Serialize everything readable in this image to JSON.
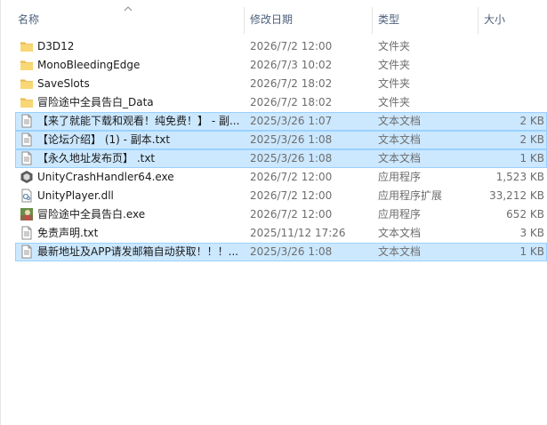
{
  "columns": {
    "name": "名称",
    "date": "修改日期",
    "type": "类型",
    "size": "大小"
  },
  "rows": [
    {
      "icon": "folder-icon",
      "name": "D3D12",
      "date": "2026/7/2 12:00",
      "type": "文件夹",
      "size": "",
      "selected": false
    },
    {
      "icon": "folder-icon",
      "name": "MonoBleedingEdge",
      "date": "2026/7/3 10:02",
      "type": "文件夹",
      "size": "",
      "selected": false
    },
    {
      "icon": "folder-icon",
      "name": "SaveSlots",
      "date": "2026/7/2 18:02",
      "type": "文件夹",
      "size": "",
      "selected": false
    },
    {
      "icon": "folder-icon",
      "name": "冒险途中全員告白_Data",
      "date": "2026/7/2 18:02",
      "type": "文件夹",
      "size": "",
      "selected": false
    },
    {
      "icon": "text-file-icon",
      "name": "【来了就能下载和观看！纯免费！】 - 副...",
      "date": "2025/3/26 1:07",
      "type": "文本文档",
      "size": "2 KB",
      "selected": true
    },
    {
      "icon": "text-file-icon",
      "name": "【论坛介绍】 (1) - 副本.txt",
      "date": "2025/3/26 1:08",
      "type": "文本文档",
      "size": "2 KB",
      "selected": true
    },
    {
      "icon": "text-file-icon",
      "name": "【永久地址发布页】 .txt",
      "date": "2025/3/26 1:08",
      "type": "文本文档",
      "size": "1 KB",
      "selected": true
    },
    {
      "icon": "unity-crash-handler-icon",
      "name": "UnityCrashHandler64.exe",
      "date": "2026/7/2 12:00",
      "type": "应用程序",
      "size": "1,523 KB",
      "selected": false
    },
    {
      "icon": "dll-file-icon",
      "name": "UnityPlayer.dll",
      "date": "2026/7/2 12:00",
      "type": "应用程序扩展",
      "size": "33,212 KB",
      "selected": false
    },
    {
      "icon": "game-exe-icon",
      "name": "冒险途中全員告白.exe",
      "date": "2026/7/2 12:00",
      "type": "应用程序",
      "size": "652 KB",
      "selected": false
    },
    {
      "icon": "text-file-icon",
      "name": "免责声明.txt",
      "date": "2025/11/12 17:26",
      "type": "文本文档",
      "size": "3 KB",
      "selected": false
    },
    {
      "icon": "text-file-icon",
      "name": "最新地址及APP请发邮箱自动获取！！！...",
      "date": "2025/3/26 1:08",
      "type": "文本文档",
      "size": "1 KB",
      "selected": true
    }
  ],
  "colors": {
    "selection_bg": "#cce8ff",
    "selection_border": "#99d1ff",
    "folder": "#f8d775",
    "header_text": "#4c607a"
  }
}
